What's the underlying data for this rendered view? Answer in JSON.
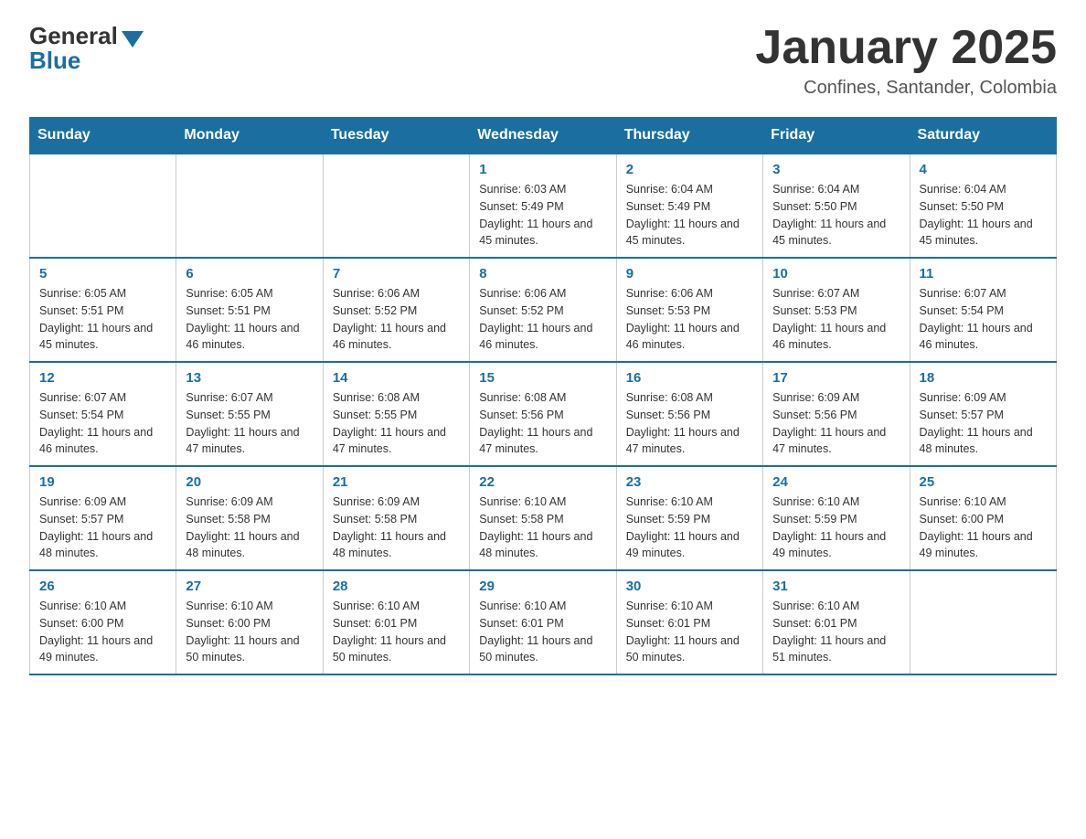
{
  "logo": {
    "general": "General",
    "blue": "Blue"
  },
  "header": {
    "title": "January 2025",
    "subtitle": "Confines, Santander, Colombia"
  },
  "weekdays": [
    "Sunday",
    "Monday",
    "Tuesday",
    "Wednesday",
    "Thursday",
    "Friday",
    "Saturday"
  ],
  "weeks": [
    [
      {
        "day": "",
        "info": ""
      },
      {
        "day": "",
        "info": ""
      },
      {
        "day": "",
        "info": ""
      },
      {
        "day": "1",
        "info": "Sunrise: 6:03 AM\nSunset: 5:49 PM\nDaylight: 11 hours and 45 minutes."
      },
      {
        "day": "2",
        "info": "Sunrise: 6:04 AM\nSunset: 5:49 PM\nDaylight: 11 hours and 45 minutes."
      },
      {
        "day": "3",
        "info": "Sunrise: 6:04 AM\nSunset: 5:50 PM\nDaylight: 11 hours and 45 minutes."
      },
      {
        "day": "4",
        "info": "Sunrise: 6:04 AM\nSunset: 5:50 PM\nDaylight: 11 hours and 45 minutes."
      }
    ],
    [
      {
        "day": "5",
        "info": "Sunrise: 6:05 AM\nSunset: 5:51 PM\nDaylight: 11 hours and 45 minutes."
      },
      {
        "day": "6",
        "info": "Sunrise: 6:05 AM\nSunset: 5:51 PM\nDaylight: 11 hours and 46 minutes."
      },
      {
        "day": "7",
        "info": "Sunrise: 6:06 AM\nSunset: 5:52 PM\nDaylight: 11 hours and 46 minutes."
      },
      {
        "day": "8",
        "info": "Sunrise: 6:06 AM\nSunset: 5:52 PM\nDaylight: 11 hours and 46 minutes."
      },
      {
        "day": "9",
        "info": "Sunrise: 6:06 AM\nSunset: 5:53 PM\nDaylight: 11 hours and 46 minutes."
      },
      {
        "day": "10",
        "info": "Sunrise: 6:07 AM\nSunset: 5:53 PM\nDaylight: 11 hours and 46 minutes."
      },
      {
        "day": "11",
        "info": "Sunrise: 6:07 AM\nSunset: 5:54 PM\nDaylight: 11 hours and 46 minutes."
      }
    ],
    [
      {
        "day": "12",
        "info": "Sunrise: 6:07 AM\nSunset: 5:54 PM\nDaylight: 11 hours and 46 minutes."
      },
      {
        "day": "13",
        "info": "Sunrise: 6:07 AM\nSunset: 5:55 PM\nDaylight: 11 hours and 47 minutes."
      },
      {
        "day": "14",
        "info": "Sunrise: 6:08 AM\nSunset: 5:55 PM\nDaylight: 11 hours and 47 minutes."
      },
      {
        "day": "15",
        "info": "Sunrise: 6:08 AM\nSunset: 5:56 PM\nDaylight: 11 hours and 47 minutes."
      },
      {
        "day": "16",
        "info": "Sunrise: 6:08 AM\nSunset: 5:56 PM\nDaylight: 11 hours and 47 minutes."
      },
      {
        "day": "17",
        "info": "Sunrise: 6:09 AM\nSunset: 5:56 PM\nDaylight: 11 hours and 47 minutes."
      },
      {
        "day": "18",
        "info": "Sunrise: 6:09 AM\nSunset: 5:57 PM\nDaylight: 11 hours and 48 minutes."
      }
    ],
    [
      {
        "day": "19",
        "info": "Sunrise: 6:09 AM\nSunset: 5:57 PM\nDaylight: 11 hours and 48 minutes."
      },
      {
        "day": "20",
        "info": "Sunrise: 6:09 AM\nSunset: 5:58 PM\nDaylight: 11 hours and 48 minutes."
      },
      {
        "day": "21",
        "info": "Sunrise: 6:09 AM\nSunset: 5:58 PM\nDaylight: 11 hours and 48 minutes."
      },
      {
        "day": "22",
        "info": "Sunrise: 6:10 AM\nSunset: 5:58 PM\nDaylight: 11 hours and 48 minutes."
      },
      {
        "day": "23",
        "info": "Sunrise: 6:10 AM\nSunset: 5:59 PM\nDaylight: 11 hours and 49 minutes."
      },
      {
        "day": "24",
        "info": "Sunrise: 6:10 AM\nSunset: 5:59 PM\nDaylight: 11 hours and 49 minutes."
      },
      {
        "day": "25",
        "info": "Sunrise: 6:10 AM\nSunset: 6:00 PM\nDaylight: 11 hours and 49 minutes."
      }
    ],
    [
      {
        "day": "26",
        "info": "Sunrise: 6:10 AM\nSunset: 6:00 PM\nDaylight: 11 hours and 49 minutes."
      },
      {
        "day": "27",
        "info": "Sunrise: 6:10 AM\nSunset: 6:00 PM\nDaylight: 11 hours and 50 minutes."
      },
      {
        "day": "28",
        "info": "Sunrise: 6:10 AM\nSunset: 6:01 PM\nDaylight: 11 hours and 50 minutes."
      },
      {
        "day": "29",
        "info": "Sunrise: 6:10 AM\nSunset: 6:01 PM\nDaylight: 11 hours and 50 minutes."
      },
      {
        "day": "30",
        "info": "Sunrise: 6:10 AM\nSunset: 6:01 PM\nDaylight: 11 hours and 50 minutes."
      },
      {
        "day": "31",
        "info": "Sunrise: 6:10 AM\nSunset: 6:01 PM\nDaylight: 11 hours and 51 minutes."
      },
      {
        "day": "",
        "info": ""
      }
    ]
  ]
}
